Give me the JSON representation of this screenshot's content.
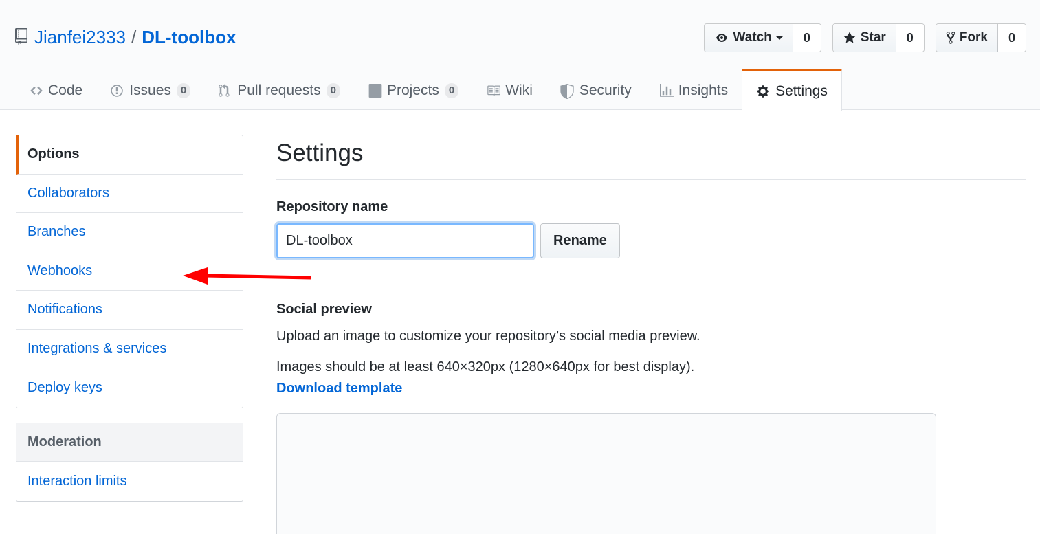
{
  "repo": {
    "owner": "Jianfei2333",
    "separator": "/",
    "name": "DL-toolbox"
  },
  "actions": [
    {
      "label": "Watch",
      "count": "0",
      "icon": "eye-icon"
    },
    {
      "label": "Star",
      "count": "0",
      "icon": "star-icon"
    },
    {
      "label": "Fork",
      "count": "0",
      "icon": "fork-icon"
    }
  ],
  "tabs": [
    {
      "label": "Code",
      "icon": "code-icon"
    },
    {
      "label": "Issues",
      "counter": "0",
      "icon": "issue-icon"
    },
    {
      "label": "Pull requests",
      "counter": "0",
      "icon": "pull-request-icon"
    },
    {
      "label": "Projects",
      "counter": "0",
      "icon": "project-icon"
    },
    {
      "label": "Wiki",
      "icon": "book-icon"
    },
    {
      "label": "Security",
      "icon": "shield-icon"
    },
    {
      "label": "Insights",
      "icon": "graph-icon"
    },
    {
      "label": "Settings",
      "icon": "gear-icon",
      "selected": true
    }
  ],
  "sidebar": {
    "items": [
      "Options",
      "Collaborators",
      "Branches",
      "Webhooks",
      "Notifications",
      "Integrations & services",
      "Deploy keys"
    ],
    "moderation_heading": "Moderation",
    "moderation_items": [
      "Interaction limits"
    ]
  },
  "main": {
    "title": "Settings",
    "repo_name_label": "Repository name",
    "repo_name_value": "DL-toolbox",
    "rename_button": "Rename",
    "social_preview_label": "Social preview",
    "social_preview_desc": "Upload an image to customize your repository’s social media preview.",
    "image_size_note": "Images should be at least 640×320px (1280×640px for best display).",
    "download_template": "Download template"
  },
  "colors": {
    "accent": "#e36209",
    "link": "#0366d6",
    "annotation_arrow": "#ff0000"
  }
}
